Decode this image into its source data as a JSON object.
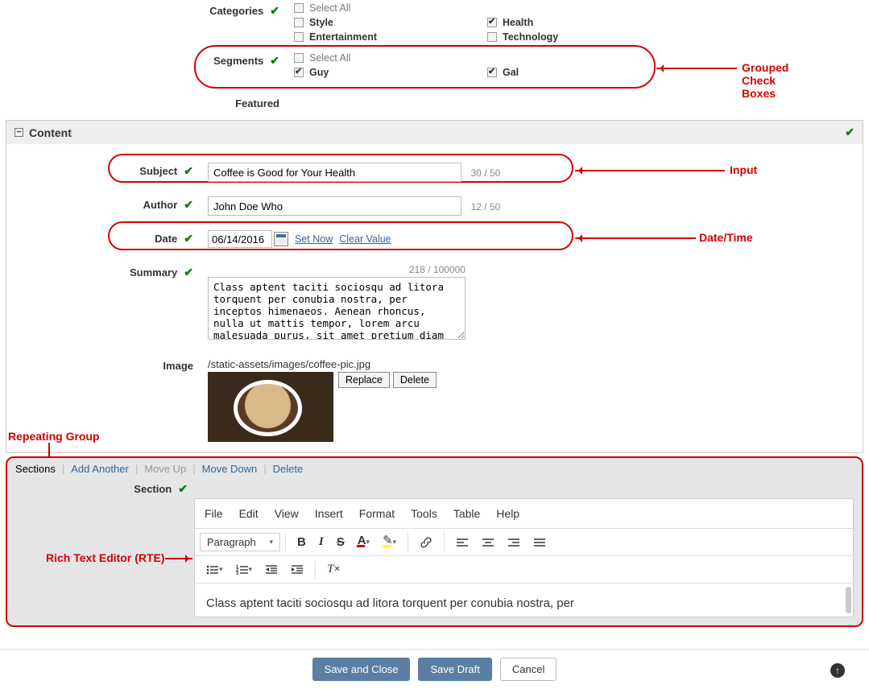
{
  "categories": {
    "label": "Categories",
    "options": {
      "select_all": "Select All",
      "style": "Style",
      "entertainment": "Entertainment",
      "health": "Health",
      "technology": "Technology"
    },
    "checked": [
      "health"
    ]
  },
  "segments": {
    "label": "Segments",
    "options": {
      "select_all": "Select All",
      "guy": "Guy",
      "gal": "Gal"
    },
    "checked": [
      "guy",
      "gal"
    ]
  },
  "featured": {
    "label": "Featured",
    "checked": false
  },
  "content_panel": {
    "title": "Content"
  },
  "subject": {
    "label": "Subject",
    "value": "Coffee is Good for Your Health",
    "counter": "30 / 50"
  },
  "author": {
    "label": "Author",
    "value": "John Doe Who",
    "counter": "12 / 50"
  },
  "date": {
    "label": "Date",
    "value": "06/14/2016",
    "set_now": "Set Now",
    "clear": "Clear Value"
  },
  "summary": {
    "label": "Summary",
    "counter": "218 / 100000",
    "value": "Class aptent taciti sociosqu ad litora torquent per conubia nostra, per inceptos himenaeos. Aenean rhoncus, nulla ut mattis tempor, lorem arcu malesuada purus, sit amet pretium diam ligula at ante. Suspendisse potenti."
  },
  "image": {
    "label": "Image",
    "path": "/static-assets/images/coffee-pic.jpg",
    "replace": "Replace",
    "delete": "Delete"
  },
  "sections": {
    "label": "Sections",
    "add": "Add Another",
    "move_up": "Move Up",
    "move_down": "Move Down",
    "delete": "Delete",
    "section_label": "Section"
  },
  "rte": {
    "menu": {
      "file": "File",
      "edit": "Edit",
      "view": "View",
      "insert": "Insert",
      "format": "Format",
      "tools": "Tools",
      "table": "Table",
      "help": "Help"
    },
    "paragraph": "Paragraph",
    "body": "Class aptent taciti sociosqu ad litora torquent per conubia nostra, per"
  },
  "footer": {
    "save_close": "Save and Close",
    "save_draft": "Save Draft",
    "cancel": "Cancel"
  },
  "annotations": {
    "grouped_cb": "Grouped Check Boxes",
    "input": "Input",
    "datetime": "Date/Time",
    "repeating": "Repeating Group",
    "rte": "Rich Text Editor (RTE)"
  }
}
